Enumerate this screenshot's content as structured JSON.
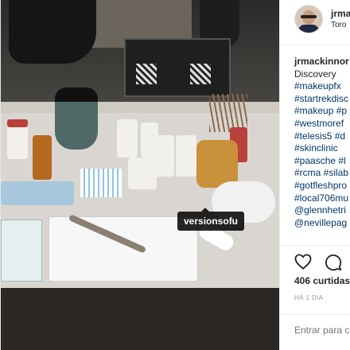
{
  "photo": {
    "user_tag": "versionsofu"
  },
  "post": {
    "username": "jrma",
    "location": "Toro",
    "avatar_icon": "profile-avatar-icon"
  },
  "caption": {
    "author": "jrmackinnor",
    "first_line": "Discovery",
    "hashtags": [
      "#makeupfx",
      "#startrekdisc",
      "#makeup #p",
      "#westmoref",
      "#telesis5 #d",
      "#skinclinic",
      "#paasche #l",
      "#rcma #silab",
      "#gotfleshpro",
      "#local706mu",
      "@glennhetri",
      "@nevillepag"
    ]
  },
  "actions": {
    "like_icon": "heart-icon",
    "comment_icon": "comment-icon"
  },
  "likes": "406 curtidas",
  "time": "HÁ 1 DIA",
  "comment": {
    "placeholder": "Entrar para c"
  },
  "colors": {
    "link": "#003569",
    "text": "#262626",
    "muted": "#999999",
    "border": "#efefef"
  }
}
